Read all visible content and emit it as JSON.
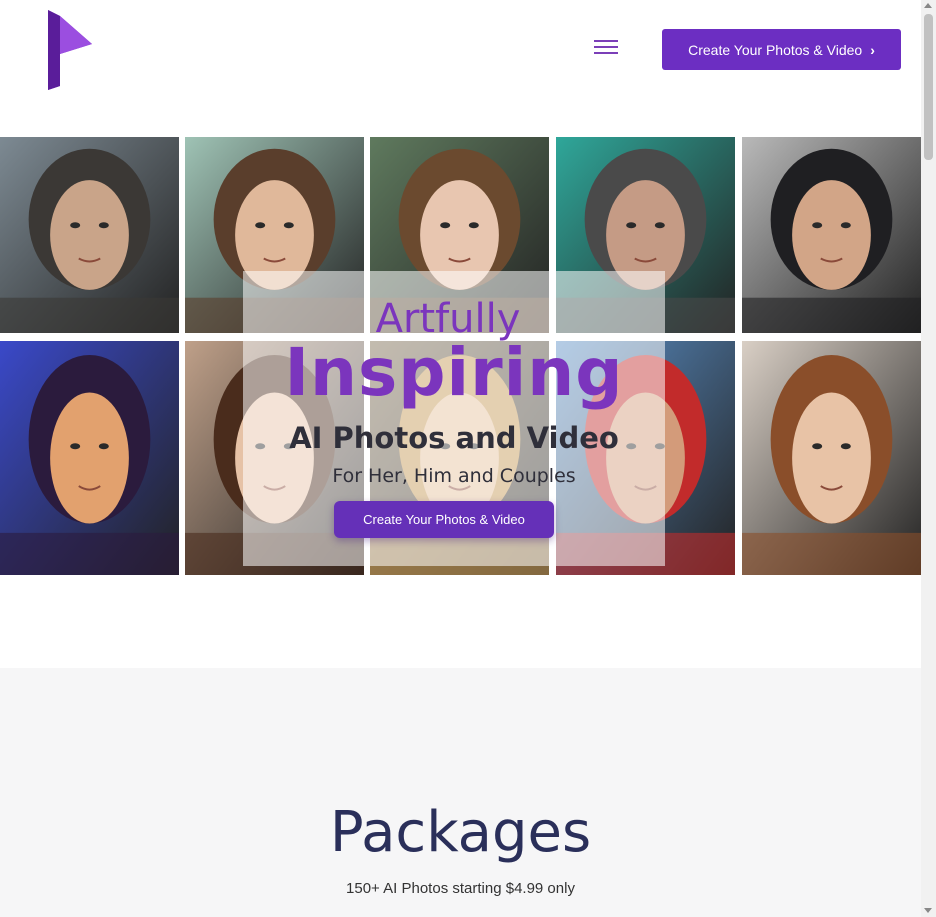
{
  "header": {
    "cta_label": "Create Your Photos & Video",
    "cta_chevron": "›"
  },
  "hero": {
    "line1": "Artfully",
    "line2": "Inspiring",
    "line3": "AI Photos and Video",
    "line4": "For Her, Him and Couples",
    "cta_label": "Create Your Photos & Video"
  },
  "gallery": {
    "tiles": [
      {
        "name": "portrait-bearded-warrior",
        "bg": "#7d8a93",
        "skin": "#c9a489",
        "hair": "#3b3835"
      },
      {
        "name": "portrait-couple-suit",
        "bg": "#9fc3b5",
        "skin": "#e0b89a",
        "hair": "#5a3e2c"
      },
      {
        "name": "portrait-woman-flowers",
        "bg": "#5f7a5e",
        "skin": "#e8c6b0",
        "hair": "#6b4a2f"
      },
      {
        "name": "portrait-teal-faces",
        "bg": "#2fa79a",
        "skin": "#c59b85",
        "hair": "#4a4a4a"
      },
      {
        "name": "portrait-armored-hero",
        "bg": "#b9b9b9",
        "skin": "#d2a587",
        "hair": "#1f1f22"
      },
      {
        "name": "portrait-neon-heroine",
        "bg": "#3a49c9",
        "skin": "#e2a16e",
        "hair": "#2b1b3d"
      },
      {
        "name": "portrait-curly-man",
        "bg": "#bfa089",
        "skin": "#e6c2a6",
        "hair": "#4a2c1c"
      },
      {
        "name": "portrait-blonde-woman",
        "bg": "#7b6a4e",
        "skin": "#e5c09c",
        "hair": "#c49853"
      },
      {
        "name": "portrait-baseball-player",
        "bg": "#5a8fc7",
        "skin": "#d39b7a",
        "hair": "#c22b2b"
      },
      {
        "name": "portrait-fairy-woman",
        "bg": "#d9cfc5",
        "skin": "#e8c3a6",
        "hair": "#8a4e2a"
      }
    ]
  },
  "packages": {
    "title": "Packages",
    "subtitle": "150+ AI Photos starting $4.99 only"
  },
  "colors": {
    "brand": "#6c2ec2",
    "heading_purple": "#7b35bd",
    "dark_text": "#2f2f3a",
    "packages_title": "#2a2f5a"
  }
}
